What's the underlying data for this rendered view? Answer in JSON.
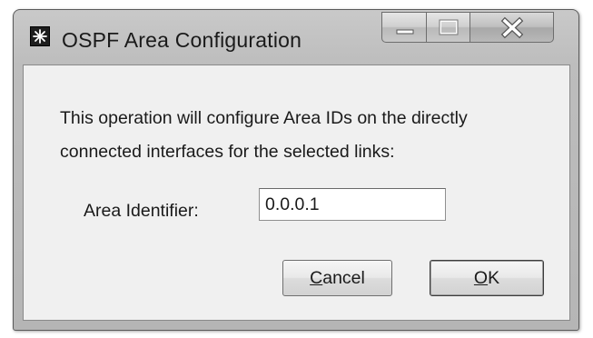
{
  "window": {
    "title": "OSPF Area Configuration",
    "icon": "star-icon"
  },
  "caption_buttons": {
    "minimize": "minimize-icon",
    "maximize": "maximize-icon",
    "close": "close-icon"
  },
  "dialog": {
    "message_line1": "This operation will configure Area IDs on the directly",
    "message_line2": "connected interfaces for the selected links:",
    "area_identifier_label": "Area Identifier:",
    "area_identifier_value": "0.0.0.1"
  },
  "buttons": {
    "cancel_mnemonic": "C",
    "cancel_rest": "ancel",
    "ok_mnemonic": "O",
    "ok_rest": "K"
  }
}
